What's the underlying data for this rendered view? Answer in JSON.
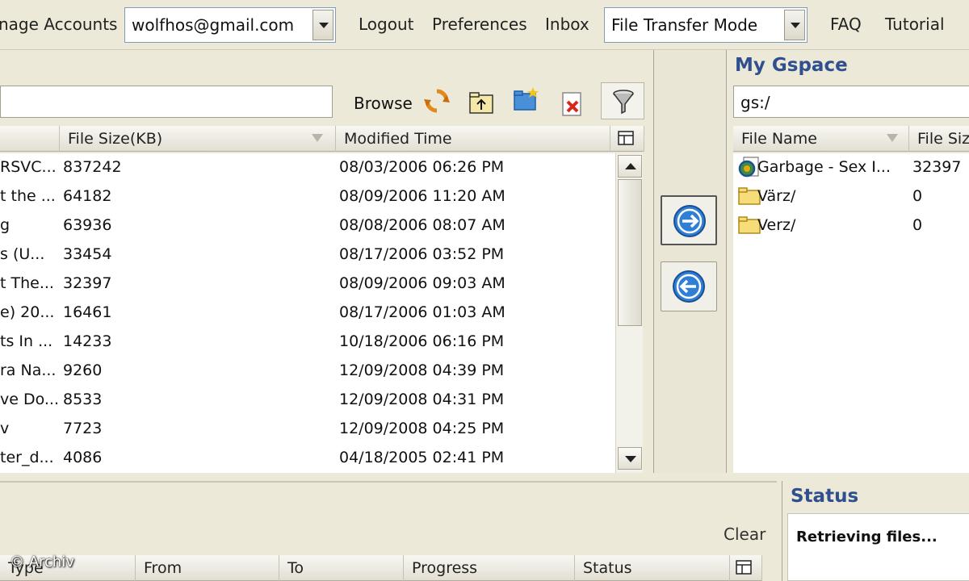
{
  "topbar": {
    "manage_accounts": "nage Accounts",
    "account": "wolfhos@gmail.com",
    "logout": "Logout",
    "preferences": "Preferences",
    "inbox": "Inbox",
    "mode": "File Transfer Mode",
    "faq": "FAQ",
    "tutorial": "Tutorial"
  },
  "local": {
    "browse": "Browse",
    "columns": [
      "File Size(KB)",
      "Modified Time"
    ],
    "rows": [
      {
        "name": "RSVC...",
        "size": "837242",
        "modified": "08/03/2006 06:26 PM"
      },
      {
        "name": "t the ...",
        "size": "64182",
        "modified": "08/09/2006 11:20 AM"
      },
      {
        "name": "g",
        "size": "63936",
        "modified": "08/08/2006 08:07 AM"
      },
      {
        "name": "s (U...",
        "size": "33454",
        "modified": "08/17/2006 03:52 PM"
      },
      {
        "name": "t The...",
        "size": "32397",
        "modified": "08/09/2006 09:03 AM"
      },
      {
        "name": "e) 20...",
        "size": "16461",
        "modified": "08/17/2006 01:03 AM"
      },
      {
        "name": "ts In ...",
        "size": "14233",
        "modified": "10/18/2006 06:16 PM"
      },
      {
        "name": "ra Na...",
        "size": "9260",
        "modified": "12/09/2008 04:39 PM"
      },
      {
        "name": "ve Do...",
        "size": "8533",
        "modified": "12/09/2008 04:31 PM"
      },
      {
        "name": "v",
        "size": "7723",
        "modified": "12/09/2008 04:25 PM"
      },
      {
        "name": "ter_d...",
        "size": "4086",
        "modified": "04/18/2005 02:41 PM"
      }
    ]
  },
  "gspace": {
    "title": "My Gspace",
    "path": "gs:/",
    "columns": [
      "File Name",
      "File Siz"
    ],
    "rows": [
      {
        "name": "Garbage - Sex I...",
        "size": "32397",
        "icon": "media-file-icon"
      },
      {
        "name": "Värz/",
        "size": "0",
        "icon": "folder-icon"
      },
      {
        "name": "Verz/",
        "size": "0",
        "icon": "folder-icon"
      }
    ]
  },
  "queue": {
    "clear": "Clear",
    "columns": [
      "Type",
      "From",
      "To",
      "Progress",
      "Status"
    ]
  },
  "status": {
    "title": "Status",
    "message": "Retrieving files..."
  },
  "watermark": "© Archiv",
  "colors": {
    "panel": "#ece9d8",
    "title_blue": "#2f4f8f",
    "arrow_blue": "#2f7fd6"
  }
}
